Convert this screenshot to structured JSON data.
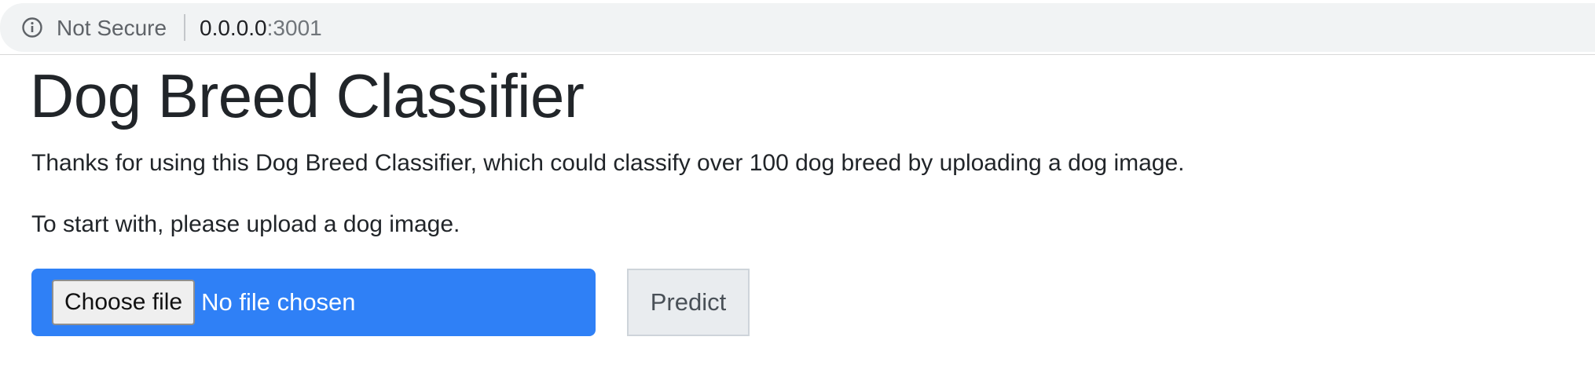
{
  "browser": {
    "security_label": "Not Secure",
    "url_host": "0.0.0.0",
    "url_port": ":3001"
  },
  "page": {
    "title": "Dog Breed Classifier",
    "intro": "Thanks for using this Dog Breed Classifier, which could classify over 100 dog breed by uploading a dog image.",
    "start_prompt": "To start with, please upload a dog image."
  },
  "upload": {
    "choose_file_label": "Choose file",
    "file_status": "No file chosen",
    "predict_label": "Predict"
  },
  "colors": {
    "file_picker_bg": "#2f80f6",
    "predict_bg": "#e9ecef",
    "address_bar_bg": "#f1f3f4"
  },
  "icons": {
    "security": "info-circle-icon"
  }
}
